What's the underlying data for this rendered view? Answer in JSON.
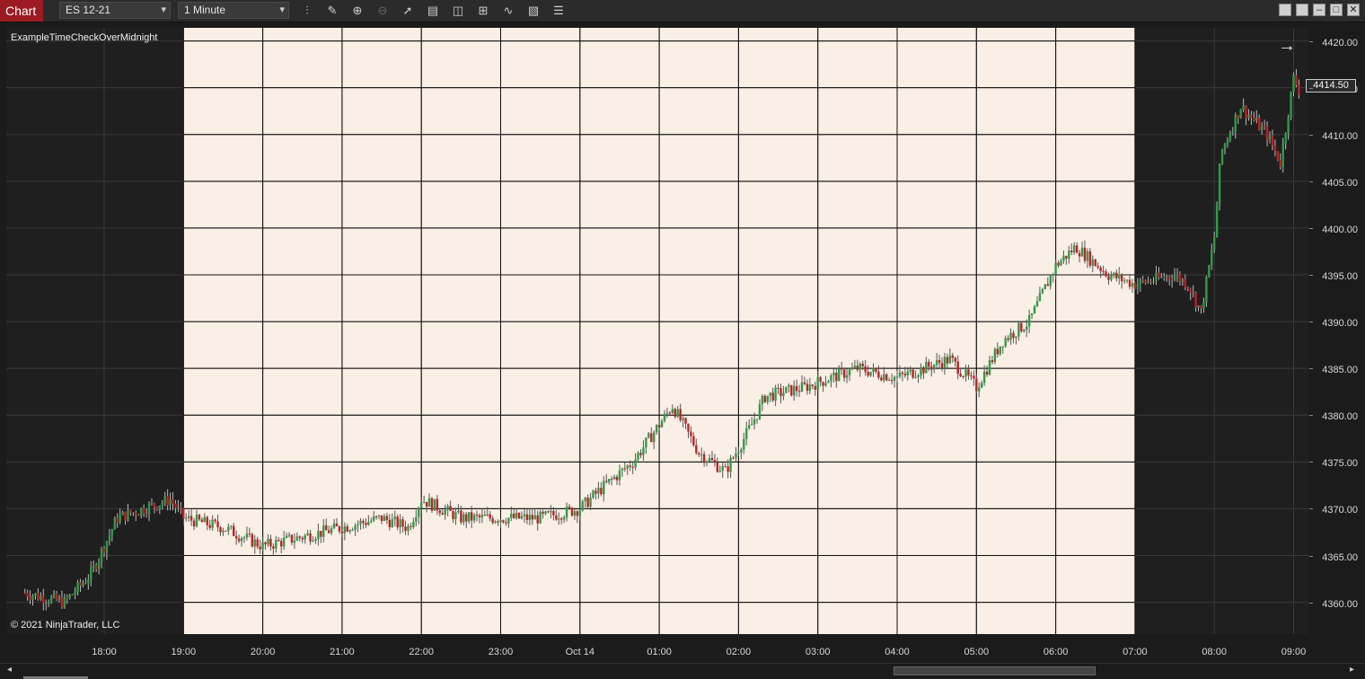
{
  "toolbar": {
    "chart_tab": "Chart",
    "instrument": "ES 12-21",
    "interval": "1 Minute",
    "tools": [
      "bar-type-icon",
      "drawing-pencil-icon",
      "zoom-in-icon",
      "zoom-out-icon",
      "pointer-icon",
      "data-box-icon",
      "templates-icon",
      "properties-icon",
      "strategies-icon",
      "indicators-icon",
      "menu-icon"
    ],
    "window_controls": [
      "restore-icon",
      "restore-icon",
      "minimize-icon",
      "maximize-icon",
      "close-icon"
    ]
  },
  "chart": {
    "indicator_label": "ExampleTimeCheckOverMidnight",
    "copyright": "© 2021 NinjaTrader, LLC",
    "current_price": "4414.50",
    "colors": {
      "session_highlight": "#faefe4",
      "background": "#1f1f1f",
      "up": "#2e9b4a",
      "down": "#c0202a"
    }
  },
  "chart_data": {
    "type": "candlestick",
    "instrument": "ES 12-21",
    "interval": "1 Minute",
    "y_tick_labels": [
      "4420.00",
      "4415.00",
      "4410.00",
      "4405.00",
      "4400.00",
      "4395.00",
      "4390.00",
      "4385.00",
      "4380.00",
      "4375.00",
      "4370.00",
      "4365.00",
      "4360.00"
    ],
    "x_tick_labels": [
      "18:00",
      "19:00",
      "20:00",
      "21:00",
      "22:00",
      "23:00",
      "Oct 14",
      "01:00",
      "02:00",
      "03:00",
      "04:00",
      "05:00",
      "06:00",
      "07:00",
      "08:00",
      "09:00"
    ],
    "ylim": [
      4356.6,
      4421.4
    ],
    "highlight_range": [
      "19:00",
      "07:00"
    ],
    "x": [
      "17:00",
      "17:30",
      "17:50",
      "18:10",
      "18:30",
      "18:50",
      "19:00",
      "19:30",
      "20:00",
      "20:30",
      "21:00",
      "21:30",
      "21:50",
      "22:00",
      "22:30",
      "23:00",
      "23:30",
      "00:00",
      "00:15",
      "00:40",
      "00:50",
      "01:10",
      "01:30",
      "01:50",
      "02:10",
      "02:20",
      "02:50",
      "03:30",
      "04:00",
      "04:40",
      "05:00",
      "05:20",
      "05:40",
      "06:00",
      "06:15",
      "06:40",
      "07:00",
      "07:30",
      "07:40",
      "07:50",
      "08:00",
      "08:05",
      "08:20",
      "08:40",
      "08:50",
      "09:00",
      "09:05"
    ],
    "close": [
      4361,
      4360,
      4363,
      4369,
      4370,
      4371,
      4369,
      4368,
      4366,
      4367,
      4368,
      4369,
      4368,
      4371,
      4369,
      4369,
      4369,
      4370,
      4372,
      4375,
      4377,
      4381,
      4376,
      4374,
      4379,
      4382,
      4383,
      4385,
      4384,
      4386,
      4383,
      4388,
      4390,
      4396,
      4398,
      4395,
      4394,
      4395,
      4394,
      4391,
      4399,
      4408,
      4413,
      4410,
      4407,
      4416,
      4414.5
    ]
  }
}
